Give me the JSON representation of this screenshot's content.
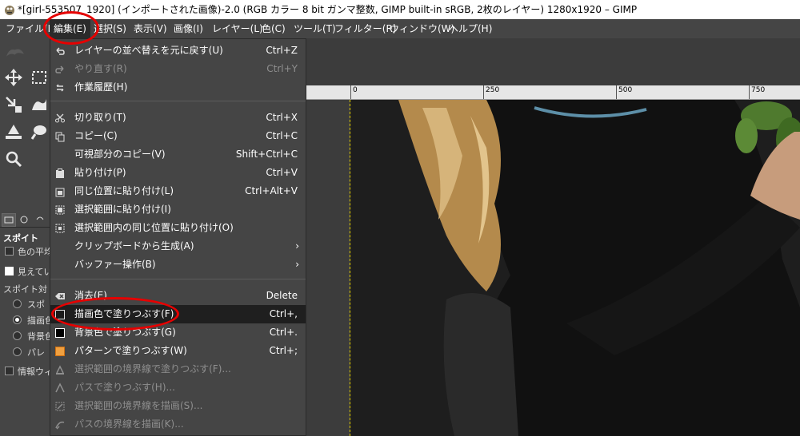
{
  "window": {
    "title": "*[girl-553507_1920] (インポートされた画像)-2.0 (RGB カラー 8 bit ガンマ整数, GIMP built-in sRGB, 2枚のレイヤー) 1280x1920 – GIMP"
  },
  "menubar": [
    {
      "label": "ファイル(F)"
    },
    {
      "label": "編集(E)"
    },
    {
      "label": "選択(S)"
    },
    {
      "label": "表示(V)"
    },
    {
      "label": "画像(I)"
    },
    {
      "label": "レイヤー(L)"
    },
    {
      "label": "色(C)"
    },
    {
      "label": "ツール(T)"
    },
    {
      "label": "フィルター(R)"
    },
    {
      "label": "ウィンドウ(W)"
    },
    {
      "label": "ヘルプ(H)"
    }
  ],
  "edit_menu": [
    {
      "label": "レイヤーの並べ替えを元に戻す(U)",
      "shortcut": "Ctrl+Z",
      "icon": "undo-icon"
    },
    {
      "label": "やり直す(R)",
      "shortcut": "Ctrl+Y",
      "icon": "redo-icon"
    },
    {
      "label": "作業履歴(H)",
      "shortcut": "",
      "icon": "history-icon"
    },
    {
      "label": "切り取り(T)",
      "shortcut": "Ctrl+X",
      "icon": "scissors-icon"
    },
    {
      "label": "コピー(C)",
      "shortcut": "Ctrl+C",
      "icon": "copy-icon"
    },
    {
      "label": "可視部分のコピー(V)",
      "shortcut": "Shift+Ctrl+C",
      "icon": ""
    },
    {
      "label": "貼り付け(P)",
      "shortcut": "Ctrl+V",
      "icon": "paste-icon"
    },
    {
      "label": "同じ位置に貼り付け(L)",
      "shortcut": "Ctrl+Alt+V",
      "icon": "paste-in-place-icon"
    },
    {
      "label": "選択範囲に貼り付け(I)",
      "shortcut": "",
      "icon": "paste-into-icon"
    },
    {
      "label": "選択範囲内の同じ位置に貼り付け(O)",
      "shortcut": "",
      "icon": "paste-into-in-place-icon"
    },
    {
      "label": "クリップボードから生成(A)",
      "shortcut": "",
      "icon": "",
      "submenu_arrow": "›"
    },
    {
      "label": "バッファー操作(B)",
      "shortcut": "",
      "icon": "",
      "submenu_arrow": "›"
    },
    {
      "label": "消去(E)",
      "shortcut": "Delete",
      "icon": "clear-icon"
    },
    {
      "label": "描画色で塗りつぶす(F)",
      "shortcut": "Ctrl+,",
      "icon": "fill-fg-icon"
    },
    {
      "label": "背景色で塗りつぶす(G)",
      "shortcut": "Ctrl+.",
      "icon": "fill-bg-icon"
    },
    {
      "label": "パターンで塗りつぶす(W)",
      "shortcut": "Ctrl+;",
      "icon": "fill-pattern-icon"
    },
    {
      "label": "選択範囲の境界線で塗りつぶす(F)...",
      "shortcut": "",
      "icon": "fill-selection-icon"
    },
    {
      "label": "パスで塗りつぶす(H)...",
      "shortcut": "",
      "icon": "fill-path-icon"
    },
    {
      "label": "選択範囲の境界線を描画(S)...",
      "shortcut": "",
      "icon": "stroke-selection-icon"
    },
    {
      "label": "パスの境界線を描画(K)...",
      "shortcut": "",
      "icon": "stroke-path-icon"
    }
  ],
  "tool_options": {
    "title": "スポイト",
    "sample_average": "色の平均",
    "sample_merged": "見えてい",
    "mode_label": "スポイト対",
    "mode_pick_only": "スポ",
    "mode_set_fg": "描画色",
    "mode_set_bg": "背景色",
    "mode_palette": "パレ",
    "use_info_window": "情報ウィ"
  },
  "ruler": {
    "labels": [
      "0",
      "250",
      "500",
      "750"
    ]
  },
  "colors": {
    "menu_bg": "#454545",
    "highlight": "#1f1f1f",
    "annotation": "#e60000",
    "guide": "#e6d200"
  }
}
